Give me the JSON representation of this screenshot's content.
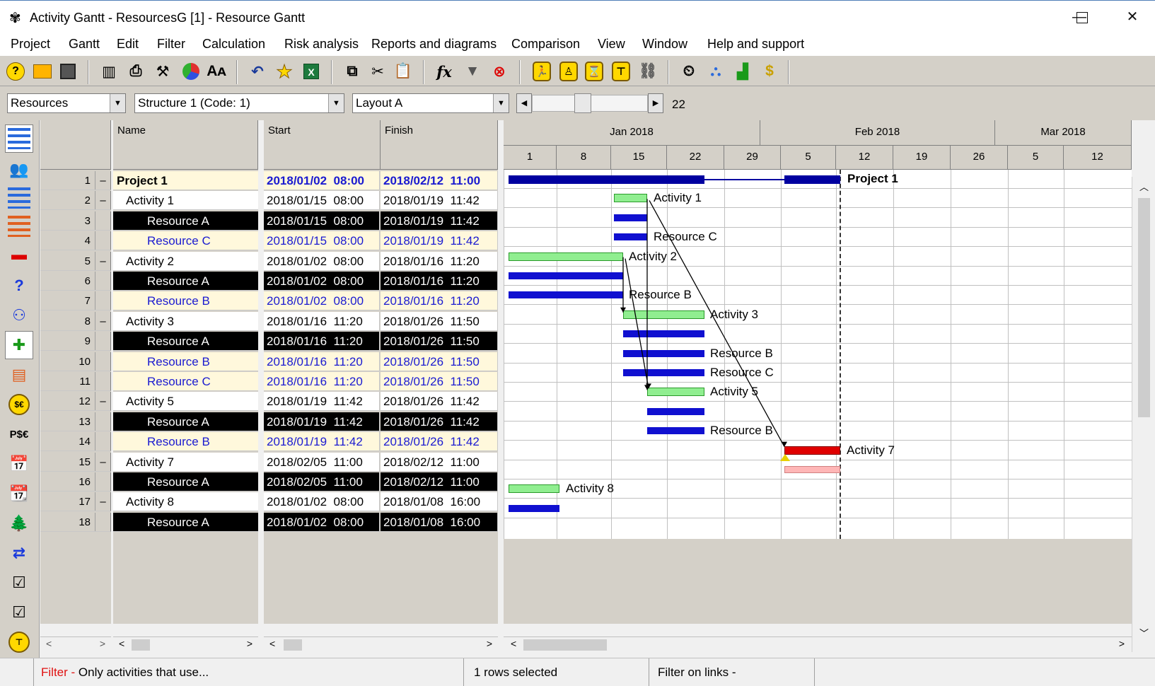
{
  "window": {
    "title": "Activity Gantt - ResourcesG [1] - Resource Gantt",
    "minimize": "—",
    "maximize": "☐",
    "close": "✕"
  },
  "menu": [
    "Project",
    "Gantt",
    "Edit",
    "Filter",
    "Calculation",
    "Risk analysis",
    "Reports and diagrams",
    "Comparison",
    "View",
    "Window",
    "Help and support"
  ],
  "combos": {
    "view": "Resources",
    "structure": "Structure 1 (Code: 1)",
    "layout": "Layout A",
    "zoom_value": "22"
  },
  "columns": {
    "name": "Name",
    "start": "Start",
    "finish": "Finish"
  },
  "timeline": {
    "months": [
      "Jan 2018",
      "Feb 2018",
      "Mar 2018"
    ],
    "days": [
      "1",
      "8",
      "15",
      "22",
      "29",
      "5",
      "12",
      "19",
      "26",
      "5",
      "12"
    ]
  },
  "rows": [
    {
      "num": "1",
      "collapse": "–",
      "name": "Project 1",
      "start": "2018/01/02  08:00",
      "finish": "2018/02/12  11:00",
      "kind": "project"
    },
    {
      "num": "2",
      "collapse": "–",
      "name": "Activity 1",
      "start": "2018/01/15  08:00",
      "finish": "2018/01/19  11:42",
      "kind": "activity"
    },
    {
      "num": "3",
      "collapse": "",
      "name": "Resource A",
      "start": "2018/01/15  08:00",
      "finish": "2018/01/19  11:42",
      "kind": "res-sel"
    },
    {
      "num": "4",
      "collapse": "",
      "name": "Resource C",
      "start": "2018/01/15  08:00",
      "finish": "2018/01/19  11:42",
      "kind": "res"
    },
    {
      "num": "5",
      "collapse": "–",
      "name": "Activity 2",
      "start": "2018/01/02  08:00",
      "finish": "2018/01/16  11:20",
      "kind": "activity"
    },
    {
      "num": "6",
      "collapse": "",
      "name": "Resource A",
      "start": "2018/01/02  08:00",
      "finish": "2018/01/16  11:20",
      "kind": "res-sel"
    },
    {
      "num": "7",
      "collapse": "",
      "name": "Resource B",
      "start": "2018/01/02  08:00",
      "finish": "2018/01/16  11:20",
      "kind": "res"
    },
    {
      "num": "8",
      "collapse": "–",
      "name": "Activity 3",
      "start": "2018/01/16  11:20",
      "finish": "2018/01/26  11:50",
      "kind": "activity"
    },
    {
      "num": "9",
      "collapse": "",
      "name": "Resource A",
      "start": "2018/01/16  11:20",
      "finish": "2018/01/26  11:50",
      "kind": "res-sel"
    },
    {
      "num": "10",
      "collapse": "",
      "name": "Resource B",
      "start": "2018/01/16  11:20",
      "finish": "2018/01/26  11:50",
      "kind": "res"
    },
    {
      "num": "11",
      "collapse": "",
      "name": "Resource C",
      "start": "2018/01/16  11:20",
      "finish": "2018/01/26  11:50",
      "kind": "res"
    },
    {
      "num": "12",
      "collapse": "–",
      "name": "Activity 5",
      "start": "2018/01/19  11:42",
      "finish": "2018/01/26  11:42",
      "kind": "activity"
    },
    {
      "num": "13",
      "collapse": "",
      "name": "Resource A",
      "start": "2018/01/19  11:42",
      "finish": "2018/01/26  11:42",
      "kind": "res-sel"
    },
    {
      "num": "14",
      "collapse": "",
      "name": "Resource B",
      "start": "2018/01/19  11:42",
      "finish": "2018/01/26  11:42",
      "kind": "res"
    },
    {
      "num": "15",
      "collapse": "–",
      "name": "Activity 7",
      "start": "2018/02/05  11:00",
      "finish": "2018/02/12  11:00",
      "kind": "activity"
    },
    {
      "num": "16",
      "collapse": "",
      "name": "Resource A",
      "start": "2018/02/05  11:00",
      "finish": "2018/02/12  11:00",
      "kind": "res-sel"
    },
    {
      "num": "17",
      "collapse": "–",
      "name": "Activity 8",
      "start": "2018/01/02  08:00",
      "finish": "2018/01/08  16:00",
      "kind": "activity"
    },
    {
      "num": "18",
      "collapse": "",
      "name": "Resource A",
      "start": "2018/01/02  08:00",
      "finish": "2018/01/08  16:00",
      "kind": "res-sel"
    }
  ],
  "gantt_labels": {
    "project": "Project 1",
    "a1": "Activity 1",
    "rc1": "Resource C",
    "a2": "Activity 2",
    "rb2": "Resource B",
    "a3": "Activity 3",
    "rb3": "Resource B",
    "rc3": "Resource C",
    "a5": "Activity 5",
    "rb5": "Resource B",
    "a7": "Activity 7",
    "a8": "Activity 8"
  },
  "status": {
    "filter_label": "Filter -",
    "filter_text": "Only activities that use...",
    "rows_selected": "1 rows selected",
    "filter_links": "Filter on links -"
  },
  "colors": {
    "activity_bar": "#90ee90",
    "resource_bar": "#1010d0",
    "project_bar": "#0000a0",
    "critical_bar": "#e00000",
    "selected_row": "#000000",
    "resource_text": "#1a1ad0"
  }
}
